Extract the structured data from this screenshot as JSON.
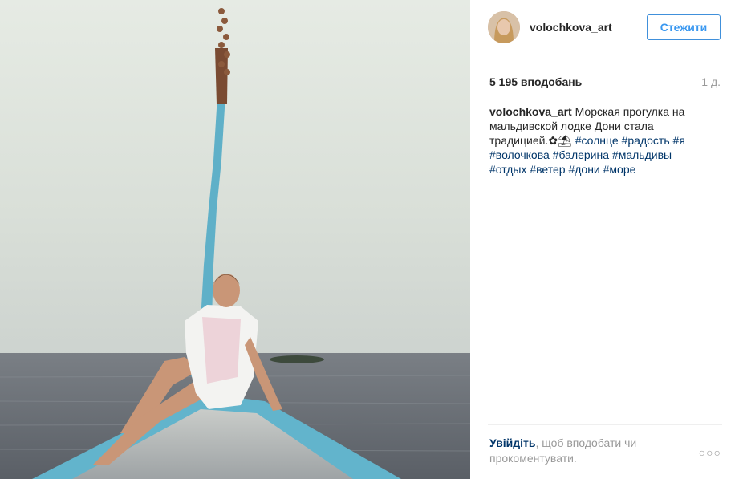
{
  "post": {
    "image_alt": "Woman in white cover-up sitting on the bow of a blue Maldivian dhoni boat at sea",
    "username": "volochkova_art",
    "follow_label": "Стежити",
    "likes": "5 195 вподобань",
    "time": "1 д.",
    "caption": {
      "user": "volochkova_art",
      "text": "Морская прогулка на мальдивской лодке Дони стала традицией.",
      "emoji": "✿⛱",
      "hashtags": [
        "#солнце",
        "#радость",
        "#я",
        "#волочкова",
        "#балерина",
        "#мальдивы",
        "#отдых",
        "#ветер",
        "#дони",
        "#море"
      ]
    },
    "login_prompt": {
      "link": "Увійдіть",
      "rest": ", щоб вподобати чи прокоментувати."
    },
    "more_icon": "ellipsis-icon",
    "more_label": "○○○"
  },
  "colors": {
    "accent": "#3897f0",
    "hashtag": "#003569",
    "muted": "#999999",
    "divider": "#efefef"
  }
}
